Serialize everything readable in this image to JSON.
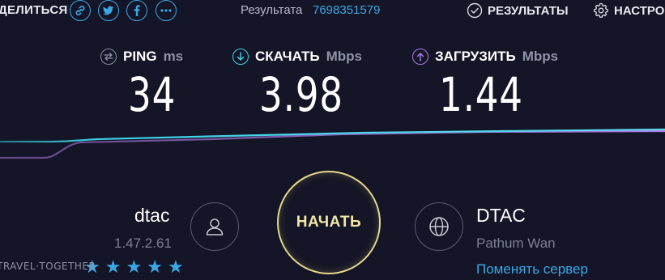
{
  "share": {
    "label": "ДЕЛИТЬСЯ",
    "buttons": [
      "link-icon",
      "twitter-icon",
      "facebook-icon",
      "more-icon"
    ]
  },
  "result": {
    "label": "Результата",
    "id": "7698351579"
  },
  "nav": {
    "results_label": "РЕЗУЛЬТАТЫ",
    "settings_label": "НАСТРО"
  },
  "metrics": {
    "ping": {
      "label": "PING",
      "unit": "ms",
      "value": "34",
      "color": "#8a8fa6"
    },
    "download": {
      "label": "СКАЧАТЬ",
      "unit": "Mbps",
      "value": "3.98",
      "color": "#3bd2e6"
    },
    "upload": {
      "label": "ЗАГРУЗИТЬ",
      "unit": "Mbps",
      "value": "1.44",
      "color": "#b07ae8"
    }
  },
  "isp": {
    "name": "dtac",
    "ip": "1.47.2.61",
    "rating_stars": 5
  },
  "server": {
    "name": "DTAC",
    "location": "Pathum Wan",
    "change_label": "Поменять сервер"
  },
  "go_button": {
    "label": "НАЧАТЬ"
  },
  "watermark": "TRAVEL·TOGETHER",
  "colors": {
    "background": "#141526",
    "accent": "#3aa8e6",
    "go": "#e6d98a"
  }
}
